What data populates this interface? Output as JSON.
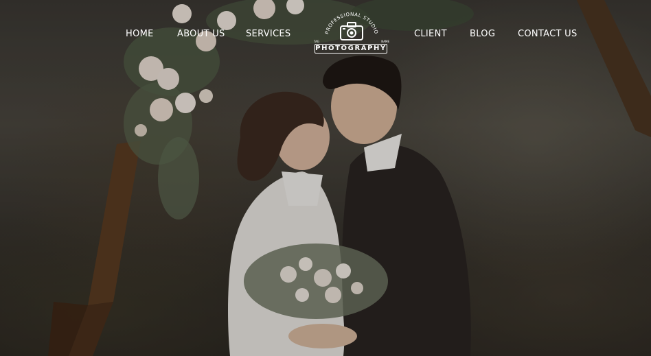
{
  "nav": {
    "left_items": [
      {
        "label": "HOME"
      },
      {
        "label": "ABOUT US"
      },
      {
        "label": "SERVICES"
      }
    ],
    "right_items": [
      {
        "label": "CLIENT"
      },
      {
        "label": "BLOG"
      },
      {
        "label": "CONTACT US"
      }
    ]
  },
  "logo": {
    "arc_text": "PROFESSIONAL STUDIO",
    "banner_text": "PHOTOGRAPHY",
    "small_left": "TAG",
    "small_right": "NAME",
    "icon": "camera-icon"
  },
  "hero": {
    "image": "wedding-couple-kissing-under-floral-arch",
    "colors": {
      "text": "#ffffff",
      "overlay": "#2a2622"
    }
  }
}
